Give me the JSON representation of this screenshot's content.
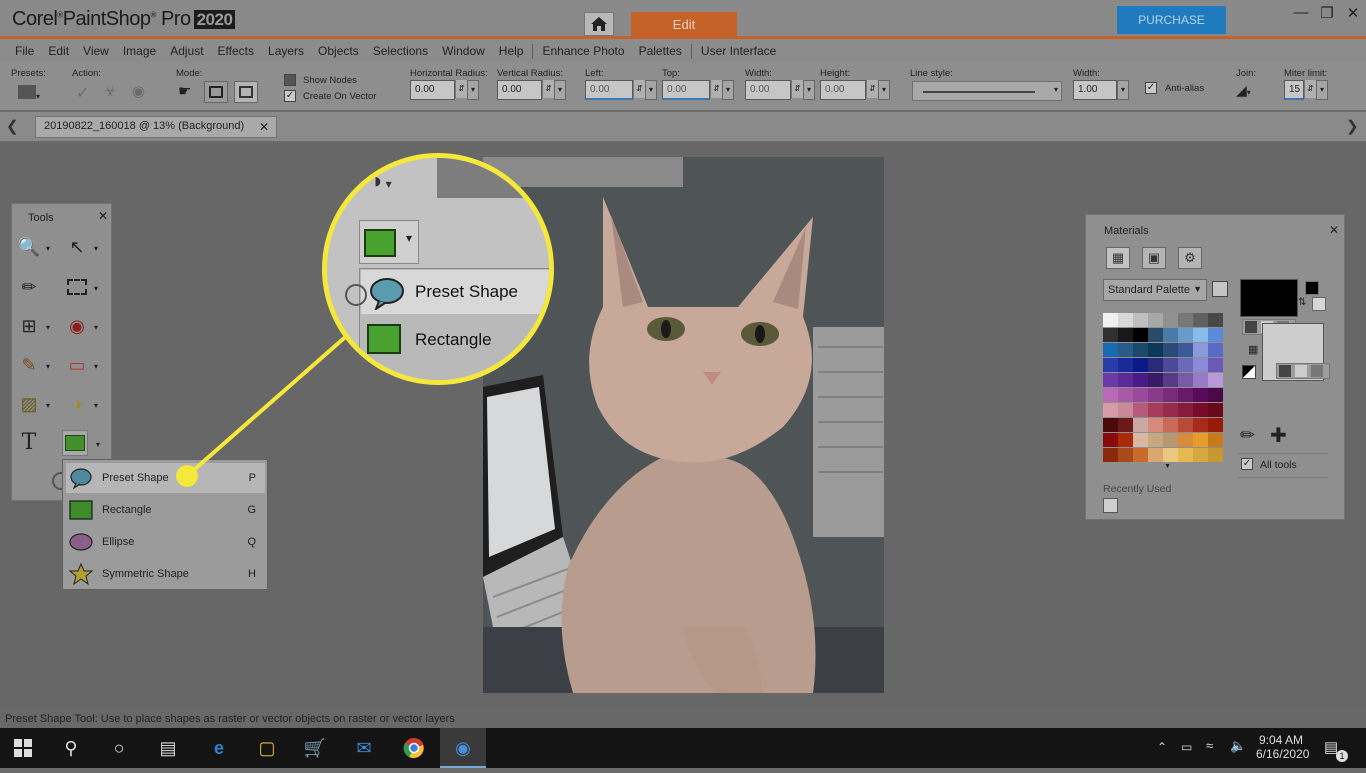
{
  "app": {
    "brand_corel": "Corel",
    "brand_psp": "PaintShop",
    "brand_pro": " Pro",
    "version": "2020",
    "tab_edit": "Edit",
    "purchase": "PURCHASE"
  },
  "menu": [
    "File",
    "Edit",
    "View",
    "Image",
    "Adjust",
    "Effects",
    "Layers",
    "Objects",
    "Selections",
    "Window",
    "Help",
    "Enhance Photo",
    "Palettes",
    "User Interface"
  ],
  "options": {
    "presets": "Presets:",
    "action": "Action:",
    "mode": "Mode:",
    "show_nodes": "Show Nodes",
    "create_on_vector": "Create On Vector",
    "h_radius_label": "Horizontal Radius:",
    "h_radius": "0.00",
    "v_radius_label": "Vertical Radius:",
    "v_radius": "0.00",
    "left_label": "Left:",
    "left": "0.00",
    "top_label": "Top:",
    "top": "0.00",
    "width_label": "Width:",
    "width": "0.00",
    "height_label": "Height:",
    "height": "0.00",
    "line_style_label": "Line style:",
    "stroke_width_label": "Width:",
    "stroke_width": "1.00",
    "anti_alias": "Anti-alias",
    "join_label": "Join:",
    "miter_label": "Miter limit:",
    "miter": "15"
  },
  "document": {
    "tab_label": "20190822_160018 @  13% (Background)"
  },
  "tools_panel": {
    "title": "Tools"
  },
  "flyout": [
    {
      "label": "Preset Shape",
      "key": "P"
    },
    {
      "label": "Rectangle",
      "key": "G"
    },
    {
      "label": "Ellipse",
      "key": "Q"
    },
    {
      "label": "Symmetric Shape",
      "key": "H"
    }
  ],
  "zoom": {
    "item1": "Preset Shape",
    "item2": "Rectangle"
  },
  "materials": {
    "title": "Materials",
    "palette_select": "Standard Palette",
    "all_tools": "All tools",
    "recently_used": "Recently Used"
  },
  "status": "Preset Shape Tool: Use to place shapes as raster or vector objects on raster or vector layers",
  "taskbar": {
    "time": "9:04 AM",
    "date": "6/16/2020",
    "notifications": "1"
  },
  "colors": {
    "accent": "#c4622a",
    "highlight": "#f5e83a",
    "purchase": "#1f7bbd"
  }
}
